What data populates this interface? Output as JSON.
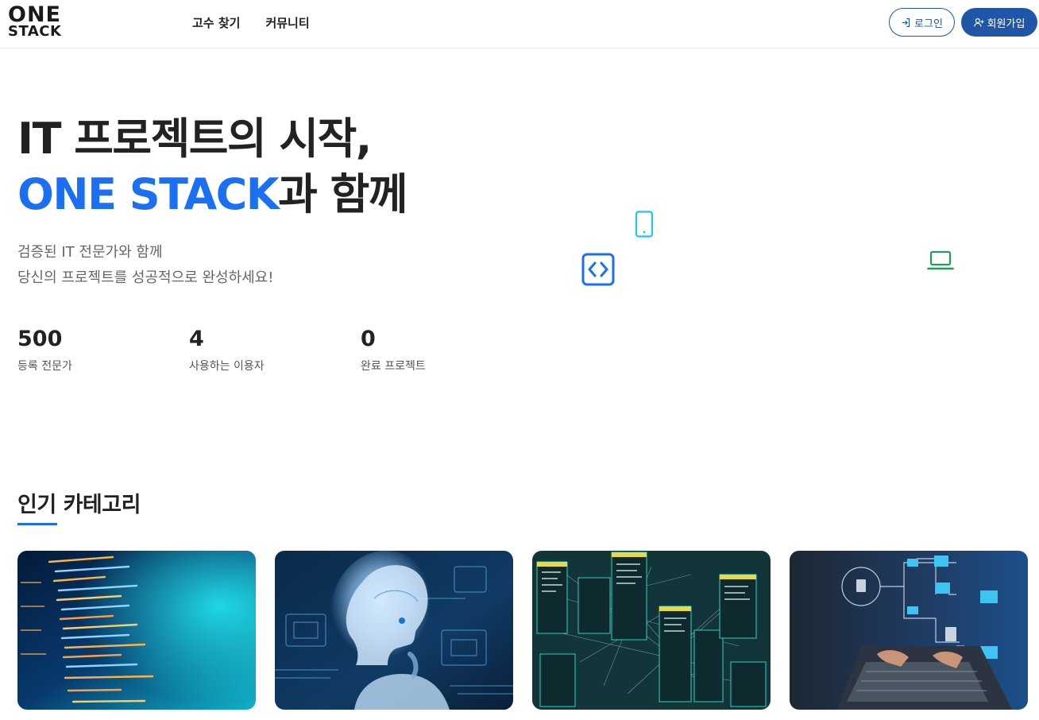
{
  "header": {
    "logo_line1": "ONE",
    "logo_line2": "STACK",
    "nav": [
      {
        "label": "고수 찾기"
      },
      {
        "label": "커뮤니티"
      }
    ],
    "login_label": "로그인",
    "signup_label": "회원가입"
  },
  "hero": {
    "title_line1": "IT 프로젝트의 시작,",
    "title_accent": "ONE STACK",
    "title_suffix": "과 함께",
    "subtitle_line1": "검증된 IT 전문가와 함께",
    "subtitle_line2": "당신의 프로젝트를 성공적으로 완성하세요!",
    "stats": [
      {
        "value": "500",
        "label": "등록 전문가"
      },
      {
        "value": "4",
        "label": "사용하는 이용자"
      },
      {
        "value": "0",
        "label": "완료 프로젝트"
      }
    ],
    "floating_icons": [
      "mobile-icon",
      "code-icon",
      "laptop-icon"
    ]
  },
  "categories": {
    "title": "인기 카테고리",
    "cards": [
      {
        "image": "code-screen-image"
      },
      {
        "image": "ai-robot-image"
      },
      {
        "image": "database-diagram-image"
      },
      {
        "image": "laptop-network-image"
      }
    ]
  },
  "colors": {
    "accent": "#1a6ff2",
    "brand_button": "#1f56a8",
    "mobile_icon": "#1ec5f0",
    "laptop_icon": "#1e9e5a"
  }
}
